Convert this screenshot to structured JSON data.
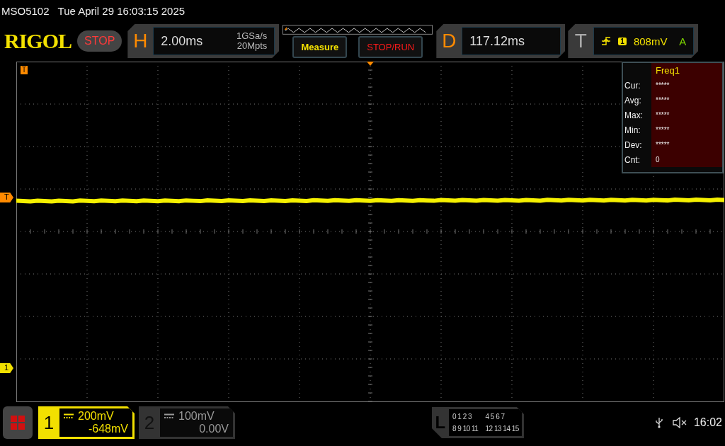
{
  "header": {
    "model": "MSO5102",
    "datetime": "Tue April 29 16:03:15 2025"
  },
  "toolbar": {
    "logo": "RIGOL",
    "run_state": "STOP",
    "horizontal": {
      "letter": "H",
      "timebase": "2.00ms",
      "sample_rate": "1GSa/s",
      "memory_depth": "20Mpts"
    },
    "measure_button": "Measure",
    "stop_run_button": "STOP/RUN",
    "delay": {
      "letter": "D",
      "value": "117.12ms"
    },
    "trigger": {
      "letter": "T",
      "source": "1",
      "level": "808mV",
      "mode": "A"
    }
  },
  "markers": {
    "trigger_position": "T",
    "trigger_level": "T",
    "channel": "1"
  },
  "measurement": {
    "title": "Freq1",
    "rows": [
      {
        "label": "Cur:",
        "value": "*****"
      },
      {
        "label": "Avg:",
        "value": "*****"
      },
      {
        "label": "Max:",
        "value": "*****"
      },
      {
        "label": "Min:",
        "value": "*****"
      },
      {
        "label": "Dev:",
        "value": "*****"
      },
      {
        "label": "Cnt:",
        "value": "0"
      }
    ]
  },
  "channels": [
    {
      "number": "1",
      "scale": "200mV",
      "offset": "-648mV",
      "on": true
    },
    {
      "number": "2",
      "scale": "100mV",
      "offset": "0.00V",
      "on": false
    }
  ],
  "logic": {
    "letter": "L",
    "groups": [
      "0 1 2 3",
      "4 5 6 7",
      "8 9 10 11",
      "12 13 14 15"
    ]
  },
  "clock": "16:02"
}
